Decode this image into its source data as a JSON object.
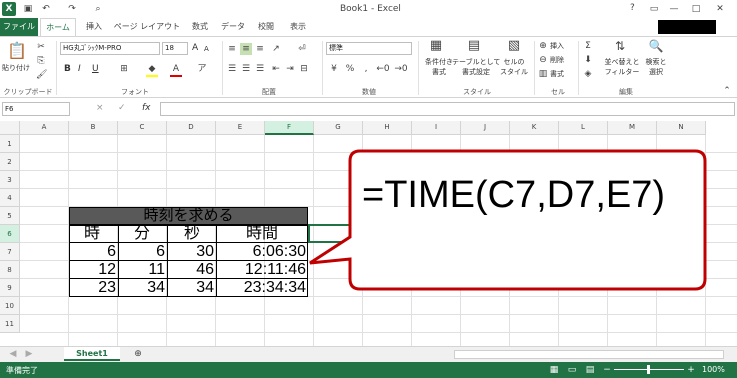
{
  "window": {
    "title": "Book1 - Excel",
    "help": "?"
  },
  "tabs": [
    "ファイル",
    "ホーム",
    "挿入",
    "ページ レイアウト",
    "数式",
    "データ",
    "校閲",
    "表示"
  ],
  "ribbon": {
    "clipboard": {
      "paste": "貼り付け",
      "label": "クリップボード"
    },
    "font": {
      "name": "HG丸ｺﾞｼｯｸM-PRO",
      "size": "18",
      "bold": "B",
      "italic": "I",
      "underline": "U",
      "grow": "A",
      "shrink": "A",
      "label": "フォント"
    },
    "alignment": {
      "label": "配置"
    },
    "number": {
      "format": "標準",
      "label": "数値"
    },
    "styles": {
      "conditional": "条件付き\n書式",
      "table": "テーブルとして\n書式設定",
      "cell": "セルの\nスタイル",
      "label": "スタイル"
    },
    "cells": {
      "insert": "挿入",
      "delete": "削除",
      "format": "書式",
      "label": "セル"
    },
    "editing": {
      "sort": "並べ替えと\nフィルター",
      "find": "検索と\n選択",
      "label": "編集"
    }
  },
  "formulabar": {
    "namebox": "F6",
    "fx": "fx",
    "cancel": "×",
    "enter": "✓",
    "value": ""
  },
  "columns": [
    "A",
    "B",
    "C",
    "D",
    "E",
    "F",
    "G",
    "H",
    "I",
    "J",
    "K",
    "L",
    "M",
    "N"
  ],
  "rows": [
    "1",
    "2",
    "3",
    "4",
    "5",
    "6",
    "7",
    "8",
    "9",
    "10",
    "11"
  ],
  "table": {
    "title": "時刻を求める",
    "headers": [
      "時",
      "分",
      "秒",
      "時間"
    ],
    "rows": [
      [
        "6",
        "6",
        "30",
        "6:06:30"
      ],
      [
        "12",
        "11",
        "46",
        "12:11:46"
      ],
      [
        "23",
        "34",
        "34",
        "23:34:34"
      ]
    ]
  },
  "callout": {
    "text": "=TIME(C7,D7,E7)"
  },
  "sheets": [
    "Sheet1"
  ],
  "status": {
    "ready": "準備完了",
    "zoom": "100%"
  }
}
